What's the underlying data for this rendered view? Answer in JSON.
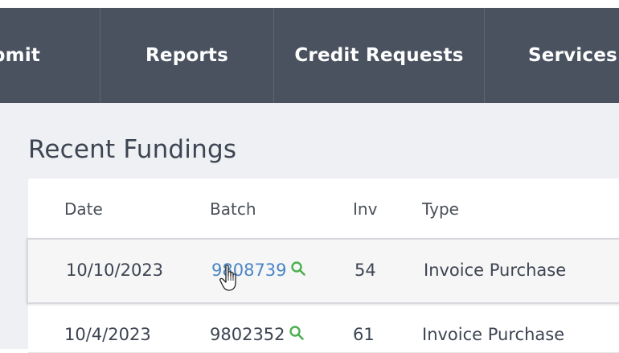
{
  "nav": {
    "items": [
      {
        "label": "bmit"
      },
      {
        "label": "Reports"
      },
      {
        "label": "Credit Requests"
      },
      {
        "label": "Services"
      }
    ]
  },
  "section": {
    "title": "Recent Fundings"
  },
  "table": {
    "headers": {
      "date": "Date",
      "batch": "Batch",
      "inv": "Inv",
      "type": "Type"
    },
    "rows": [
      {
        "date": "10/10/2023",
        "batch": "9808739",
        "inv": "54",
        "type": "Invoice Purchase"
      },
      {
        "date": "10/4/2023",
        "batch": "9802352",
        "inv": "61",
        "type": "Invoice Purchase"
      }
    ]
  },
  "colors": {
    "navbar": "#4a5260",
    "link": "#4a86c5",
    "search_icon": "#4caf50",
    "content_bg": "#eef0f3"
  },
  "icons": {
    "batch_search": "search-icon",
    "pointer": "hand-cursor-icon"
  }
}
